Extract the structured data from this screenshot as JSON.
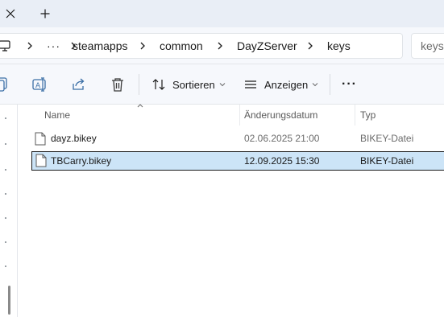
{
  "tabs": {
    "close_glyph": "✕",
    "new_glyph": "+"
  },
  "breadcrumb": {
    "overflow": "···",
    "items": [
      "steamapps",
      "common",
      "DayZServer",
      "keys"
    ]
  },
  "search": {
    "placeholder": "keys"
  },
  "toolbar": {
    "sort_label": "Sortieren",
    "view_label": "Anzeigen",
    "more_glyph": "···"
  },
  "columns": {
    "name": "Name",
    "date": "Änderungsdatum",
    "type": "Typ"
  },
  "files": [
    {
      "name": "dayz.bikey",
      "date": "02.06.2025 21:00",
      "type": "BIKEY-Datei",
      "selected": false
    },
    {
      "name": "TBCarry.bikey",
      "date": "12.09.2025 15:30",
      "type": "BIKEY-Datei",
      "selected": true
    }
  ],
  "colors": {
    "selection": "#cce4f7",
    "toolbar_bg": "#f6f8fc",
    "tab_bg": "#e9eef6"
  }
}
